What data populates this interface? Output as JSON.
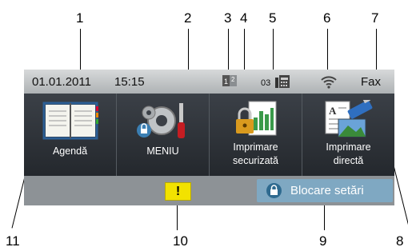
{
  "callouts": [
    "1",
    "2",
    "3",
    "4",
    "5",
    "6",
    "7",
    "8",
    "9",
    "10",
    "11"
  ],
  "status": {
    "date": "01.01.2011",
    "time": "15:15",
    "fax_count": "03",
    "mode": "Fax"
  },
  "tiles": [
    {
      "label": "Agendă",
      "icon": "address-book-icon"
    },
    {
      "label": "MENIU",
      "icon": "settings-gear-icon"
    },
    {
      "label_line1": "Imprimare",
      "label_line2": "securizată",
      "icon": "secure-print-icon"
    },
    {
      "label_line1": "Imprimare",
      "label_line2": "directă",
      "icon": "direct-print-icon"
    }
  ],
  "bottom": {
    "warning_symbol": "!",
    "lock_label": "Blocare setări"
  }
}
